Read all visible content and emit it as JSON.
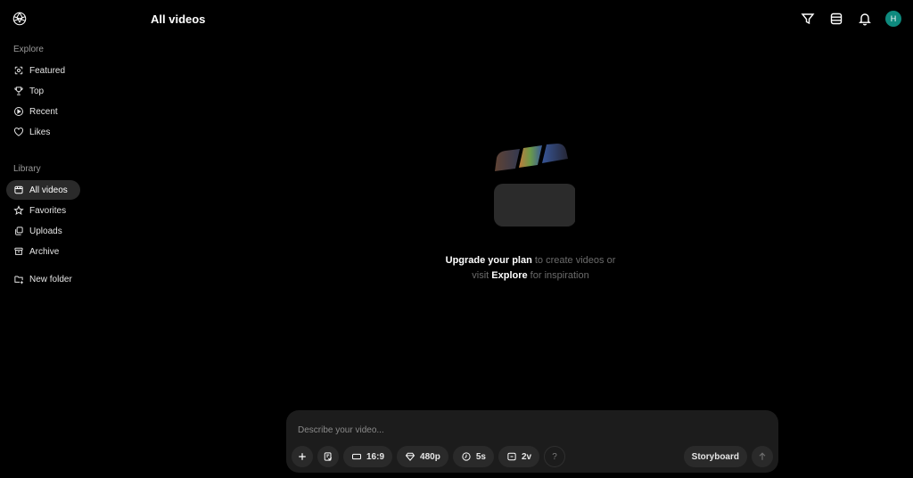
{
  "page": {
    "title": "All videos"
  },
  "sidebar": {
    "explore_title": "Explore",
    "explore_items": [
      {
        "label": "Featured",
        "icon": "featured-icon"
      },
      {
        "label": "Top",
        "icon": "trophy-icon"
      },
      {
        "label": "Recent",
        "icon": "play-circle-icon"
      },
      {
        "label": "Likes",
        "icon": "heart-icon"
      }
    ],
    "library_title": "Library",
    "library_items": [
      {
        "label": "All videos",
        "icon": "video-library-icon",
        "active": true
      },
      {
        "label": "Favorites",
        "icon": "star-icon"
      },
      {
        "label": "Uploads",
        "icon": "uploads-icon"
      },
      {
        "label": "Archive",
        "icon": "archive-icon"
      }
    ],
    "new_folder": "New folder"
  },
  "header": {
    "avatar_initial": "H",
    "avatar_color": "#0e8a7e"
  },
  "empty_state": {
    "upgrade_link": "Upgrade your plan",
    "line1_rest": " to create videos or",
    "line2_start": "visit ",
    "explore_link": "Explore",
    "line2_rest": " for inspiration"
  },
  "composer": {
    "placeholder": "Describe your video...",
    "aspect_ratio": "16:9",
    "resolution": "480p",
    "duration": "5s",
    "variations": "2v",
    "help": "?",
    "storyboard": "Storyboard"
  }
}
